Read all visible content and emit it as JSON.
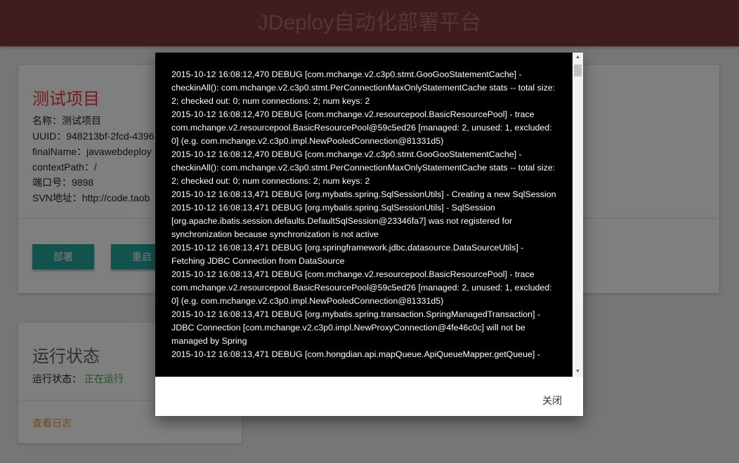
{
  "app": {
    "title": "JDeploy自动化部署平台"
  },
  "project": {
    "title": "测试项目",
    "info": [
      "名称：测试项目",
      "UUID：948213bf-2fcd-4396",
      "finalName：javawebdeploy",
      "contextPath：/",
      "端口号：9898",
      "SVN地址：http://code.taob"
    ],
    "deploy_label": "部署",
    "restart_label": "重启"
  },
  "status": {
    "title": "运行状态",
    "label": "运行状态：",
    "value": "正在运行",
    "log_link": "查看日志"
  },
  "modal": {
    "log_lines": [
      "2015-10-12 16:08:12,470 DEBUG [com.mchange.v2.c3p0.stmt.GooGooStatementCache] - checkinAll(): com.mchange.v2.c3p0.stmt.PerConnectionMaxOnlyStatementCache stats -- total size: 2; checked out: 0; num connections: 2; num keys: 2",
      "2015-10-12 16:08:12,470 DEBUG [com.mchange.v2.resourcepool.BasicResourcePool] - trace com.mchange.v2.resourcepool.BasicResourcePool@59c5ed26 [managed: 2, unused: 1, excluded: 0] (e.g. com.mchange.v2.c3p0.impl.NewPooledConnection@81331d5)",
      "2015-10-12 16:08:12,470 DEBUG [com.mchange.v2.c3p0.stmt.GooGooStatementCache] - checkinAll(): com.mchange.v2.c3p0.stmt.PerConnectionMaxOnlyStatementCache stats -- total size: 2; checked out: 0; num connections: 2; num keys: 2",
      "2015-10-12 16:08:13,471 DEBUG [org.mybatis.spring.SqlSessionUtils] - Creating a new SqlSession",
      "2015-10-12 16:08:13,471 DEBUG [org.mybatis.spring.SqlSessionUtils] - SqlSession [org.apache.ibatis.session.defaults.DefaultSqlSession@23346fa7] was not registered for synchronization because synchronization is not active",
      "2015-10-12 16:08:13,471 DEBUG [org.springframework.jdbc.datasource.DataSourceUtils] - Fetching JDBC Connection from DataSource",
      "2015-10-12 16:08:13,471 DEBUG [com.mchange.v2.resourcepool.BasicResourcePool] - trace com.mchange.v2.resourcepool.BasicResourcePool@59c5ed26 [managed: 2, unused: 1, excluded: 0] (e.g. com.mchange.v2.c3p0.impl.NewPooledConnection@81331d5)",
      "2015-10-12 16:08:13,471 DEBUG [org.mybatis.spring.transaction.SpringManagedTransaction] - JDBC Connection [com.mchange.v2.c3p0.impl.NewProxyConnection@4fe46c0c] will not be managed by Spring",
      "2015-10-12 16:08:13,471 DEBUG [com.hongdian.api.mapQueue.ApiQueueMapper.getQueue] -"
    ],
    "close_label": "关闭"
  }
}
